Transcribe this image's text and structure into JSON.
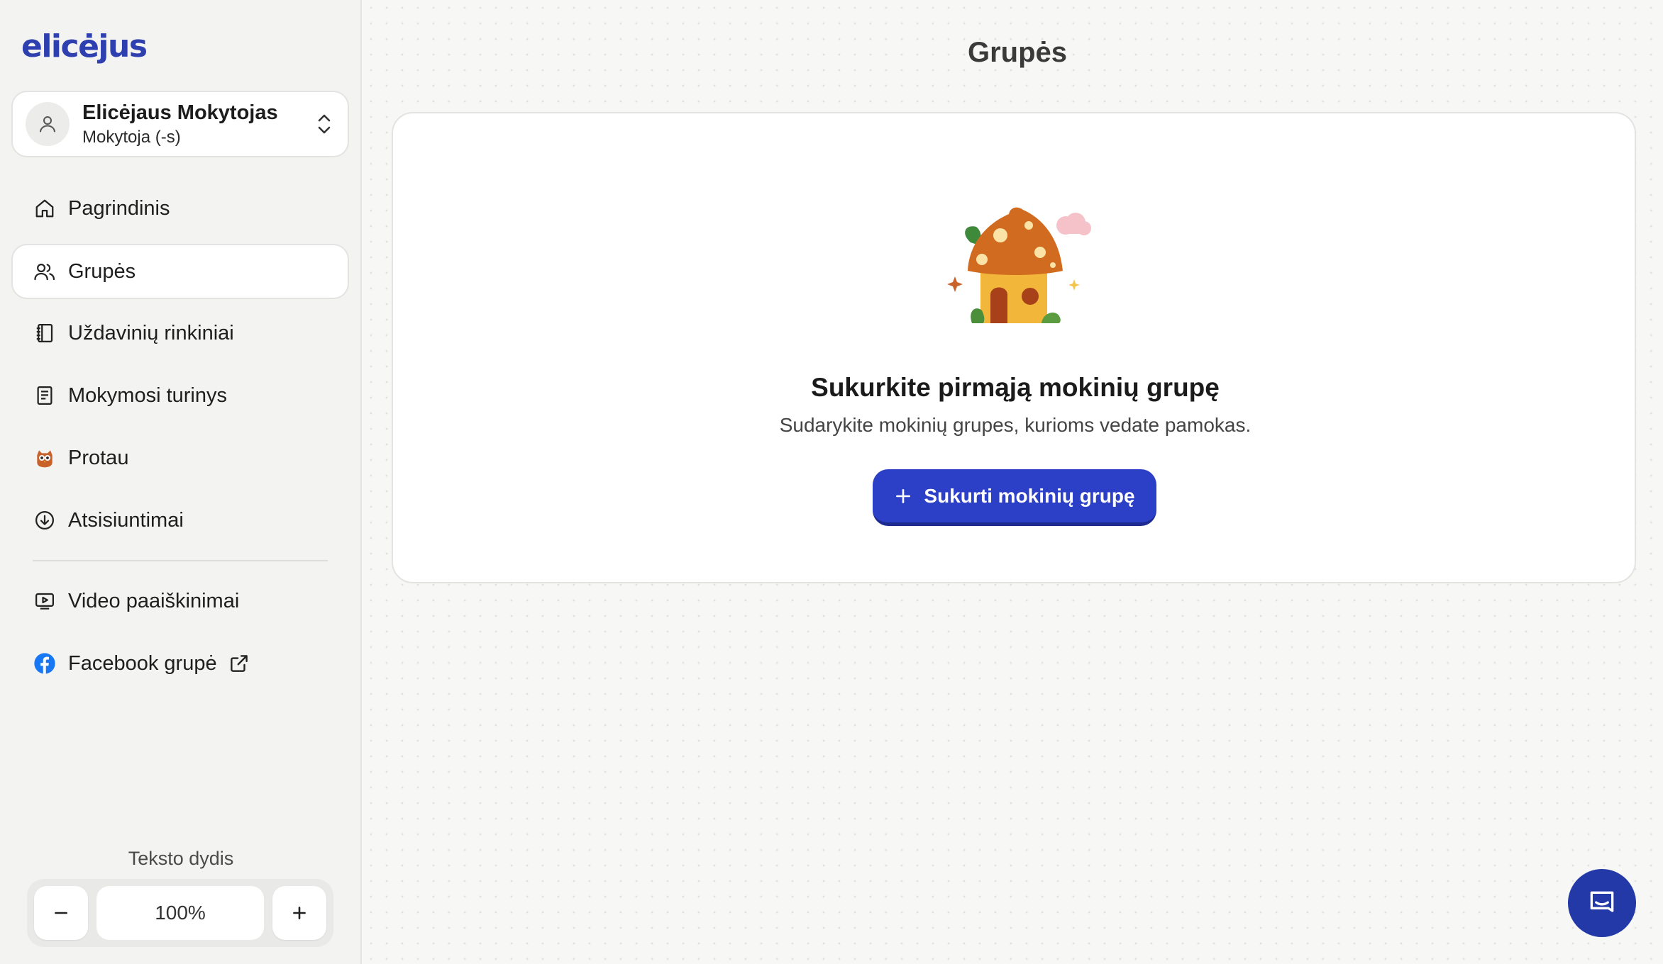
{
  "brand": {
    "logo_text": "elicėjus",
    "accent": "#2c3fc7"
  },
  "user": {
    "name": "Elicėjaus Mokytojas",
    "role": "Mokytoja (-s)"
  },
  "nav": {
    "items": [
      {
        "label": "Pagrindinis",
        "icon": "home-icon",
        "active": false
      },
      {
        "label": "Grupės",
        "icon": "users-icon",
        "active": true
      },
      {
        "label": "Uždavinių rinkiniai",
        "icon": "notebook-icon",
        "active": false
      },
      {
        "label": "Mokymosi turinys",
        "icon": "document-icon",
        "active": false
      },
      {
        "label": "Protau",
        "icon": "owl-icon",
        "active": false
      },
      {
        "label": "Atsisiuntimai",
        "icon": "download-icon",
        "active": false
      }
    ],
    "secondary": [
      {
        "label": "Video paaiškinimai",
        "icon": "video-icon"
      },
      {
        "label": "Facebook grupė",
        "icon": "facebook-icon",
        "external": true
      }
    ]
  },
  "text_size": {
    "label": "Teksto dydis",
    "value": "100%",
    "decrease_icon": "minus-icon",
    "increase_icon": "plus-icon"
  },
  "page": {
    "title": "Grupės"
  },
  "empty_state": {
    "illustration": "mushroom-house-illustration",
    "title": "Sukurkite pirmąją mokinių grupę",
    "subtitle": "Sudarykite mokinių grupes, kurioms vedate pamokas.",
    "button_label": "Sukurti mokinių grupę"
  },
  "chat": {
    "icon": "chat-icon"
  }
}
